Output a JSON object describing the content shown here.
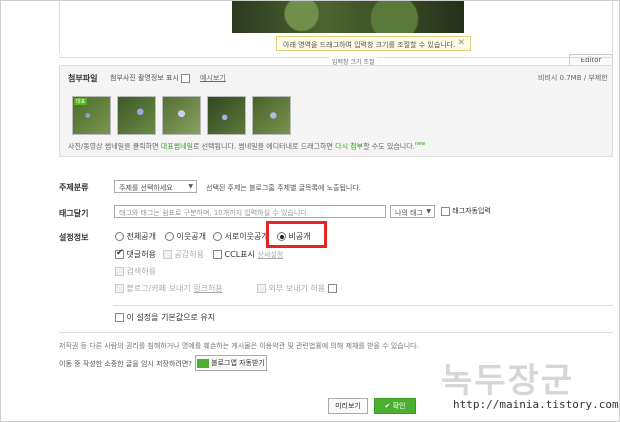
{
  "editor": {
    "resize_tip": "아래 영역을 드래그하여 입력창 크기를 조절할 수 있습니다.",
    "resize_bar_label": "입력창 크기 조절",
    "editor_tab": "Editor"
  },
  "attach": {
    "title": "첨부파일",
    "show_exif_label": "첨부사진 촬영정보 표시",
    "example_link": "예시보기",
    "info": "비비시 0.7MB / 부제한",
    "thumbnail_badge": "대표",
    "help_prefix": "사진/동영상 썸네일을 클릭하면 ",
    "help_link1": "대표썸네일",
    "help_mid": "로 선택됩니다. 썸네일을 에디터내로 드래그하면 ",
    "help_link2": "다시 첨부",
    "help_suffix": "할 수도 있습니다.",
    "help_new": "new"
  },
  "topic": {
    "label": "주제분류",
    "select_value": "주제를 선택하세요",
    "note": "선택된 주제는 블로그홈 주제별 글목록에 노출됩니다."
  },
  "tags": {
    "label": "태그달기",
    "placeholder": "태그와 태그는 쉼표로 구분하며, 10개까지 입력하실 수 있습니다.",
    "my_tags_button": "나의 태그",
    "auto_input_label": "태그자동입력"
  },
  "settings": {
    "label": "설정정보",
    "radios": [
      "전체공개",
      "이웃공개",
      "서로이웃공개",
      "비공개"
    ],
    "comment_allow": "댓글허용",
    "sympathy_allow": "공감허용",
    "ccl_label": "CCL표시",
    "ccl_setting": "상세설정",
    "search_allow": "검색허용",
    "blog_send": "블로그/카페 보내기",
    "link_allow": "링크허용",
    "external_send": "외부 보내기 허용",
    "save_default": "이 설정을 기본값으로 유지"
  },
  "footer": {
    "notice": "저작권 등 다른 사람의 권리를 침해하거나 명예를 훼손하는 게시물은 이용약관 및 관련법률에 의해 제재를 받을 수 있습니다.",
    "draft_notice": "이동 중 작성한 소중한 글을 임시 저장하려면?",
    "blog_app_button": "블로그앱 자동받기",
    "preview_button": "미리보기",
    "confirm_button": "확인"
  },
  "watermark": {
    "text": "녹두장군",
    "url": "http://mainia.tistory.com"
  }
}
